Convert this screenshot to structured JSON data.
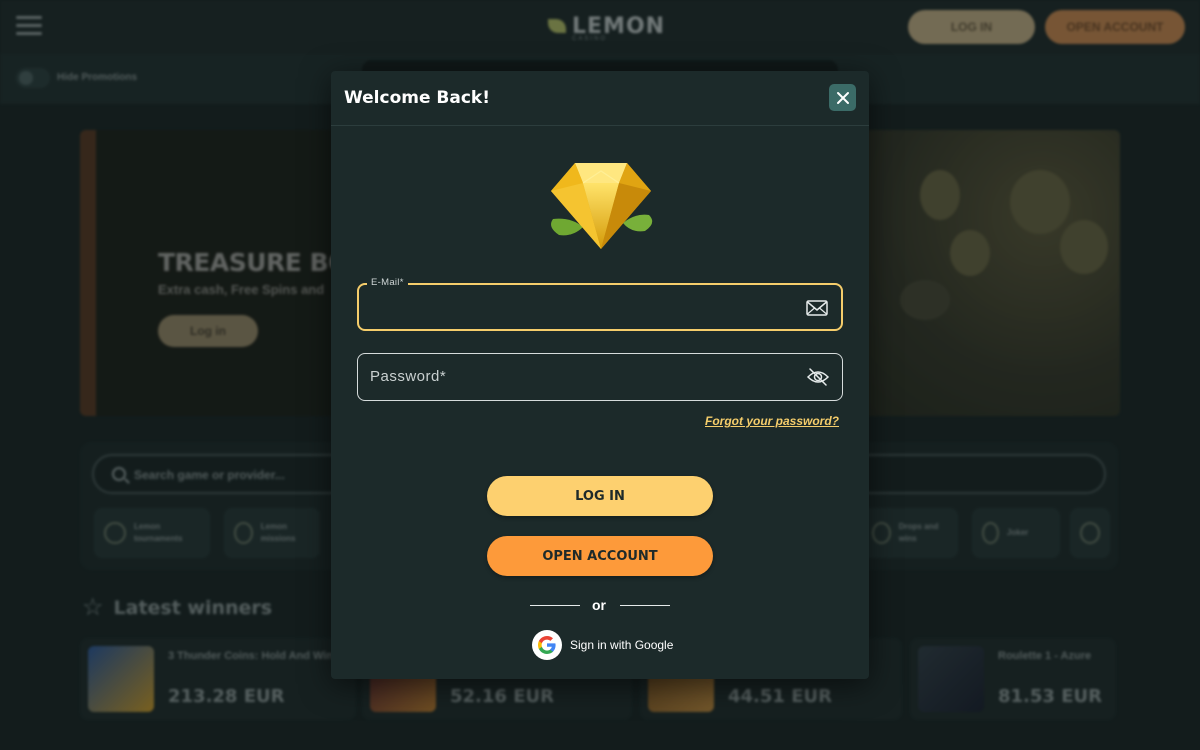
{
  "header": {
    "logo_text": "LEMON",
    "logo_subtext": "CASINO",
    "login_label": "LOG IN",
    "open_account_label": "OPEN ACCOUNT"
  },
  "promotions": {
    "hide_label": "Hide Promotions"
  },
  "banner": {
    "title": "TREASURE BOX",
    "subtitle": "Extra cash, Free Spins and",
    "button_label": "Log in"
  },
  "search": {
    "placeholder": "Search game or provider..."
  },
  "categories": [
    {
      "label": "Lemon tournaments"
    },
    {
      "label": "Lemon missions"
    },
    {
      "label": "Drops and wins"
    },
    {
      "label": "Joker"
    }
  ],
  "winners": {
    "title": "Latest winners",
    "items": [
      {
        "name": "3 Thunder Coins: Hold And Win",
        "amount": "213.28 EUR"
      },
      {
        "name": "",
        "amount": "52.16 EUR"
      },
      {
        "name": "",
        "amount": "44.51 EUR"
      },
      {
        "name": "Roulette 1 - Azure",
        "amount": "81.53 EUR"
      }
    ]
  },
  "modal": {
    "title": "Welcome Back!",
    "email_label": "E-Mail*",
    "email_value": "",
    "password_placeholder": "Password*",
    "password_value": "",
    "forgot_label": "Forgot your password?",
    "login_label": "LOG IN",
    "open_account_label": "OPEN ACCOUNT",
    "or_label": "or",
    "google_label": "Sign in with Google"
  },
  "colors": {
    "accent_yellow": "#fdd06f",
    "accent_orange": "#fd9a3a",
    "modal_bg": "#1c2a2a",
    "close_bg": "#3b6b67"
  }
}
